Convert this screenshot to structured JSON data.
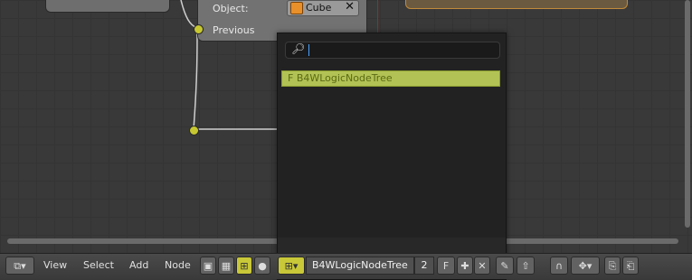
{
  "canvas": {
    "nodes": {
      "object_label": "Object:",
      "object_value": "Cube",
      "previous_label": "Previous"
    }
  },
  "search_popup": {
    "query": "",
    "items": [
      {
        "label": "F B4WLogicNodeTree",
        "highlighted": true
      }
    ]
  },
  "header": {
    "menus": [
      "View",
      "Select",
      "Add",
      "Node"
    ],
    "node_tree_name": "B4WLogicNodeTree",
    "users_count": "2",
    "fake_user_label": "F"
  },
  "icons": {
    "search": "search-icon",
    "cube": "cube-icon",
    "clear": "close-icon",
    "editor_type": "node-editor-icon",
    "shader": "shader-nodes-icon",
    "texture": "texture-nodes-icon",
    "logic": "logic-nodes-icon",
    "material_ball": "material-ball-icon",
    "browse": "browse-node-tree-icon",
    "new": "plus-icon",
    "unlink": "x-icon",
    "pin": "pin-icon",
    "parent": "go-to-parent-icon",
    "snap": "snap-icon",
    "snap_mode": "snap-mode-icon",
    "copy": "copy-icon",
    "paste": "paste-icon"
  },
  "colors": {
    "highlight": "#b2c254",
    "socket": "#c7c831",
    "cube_orange": "#e9902a",
    "link_red": "#aa2222"
  }
}
